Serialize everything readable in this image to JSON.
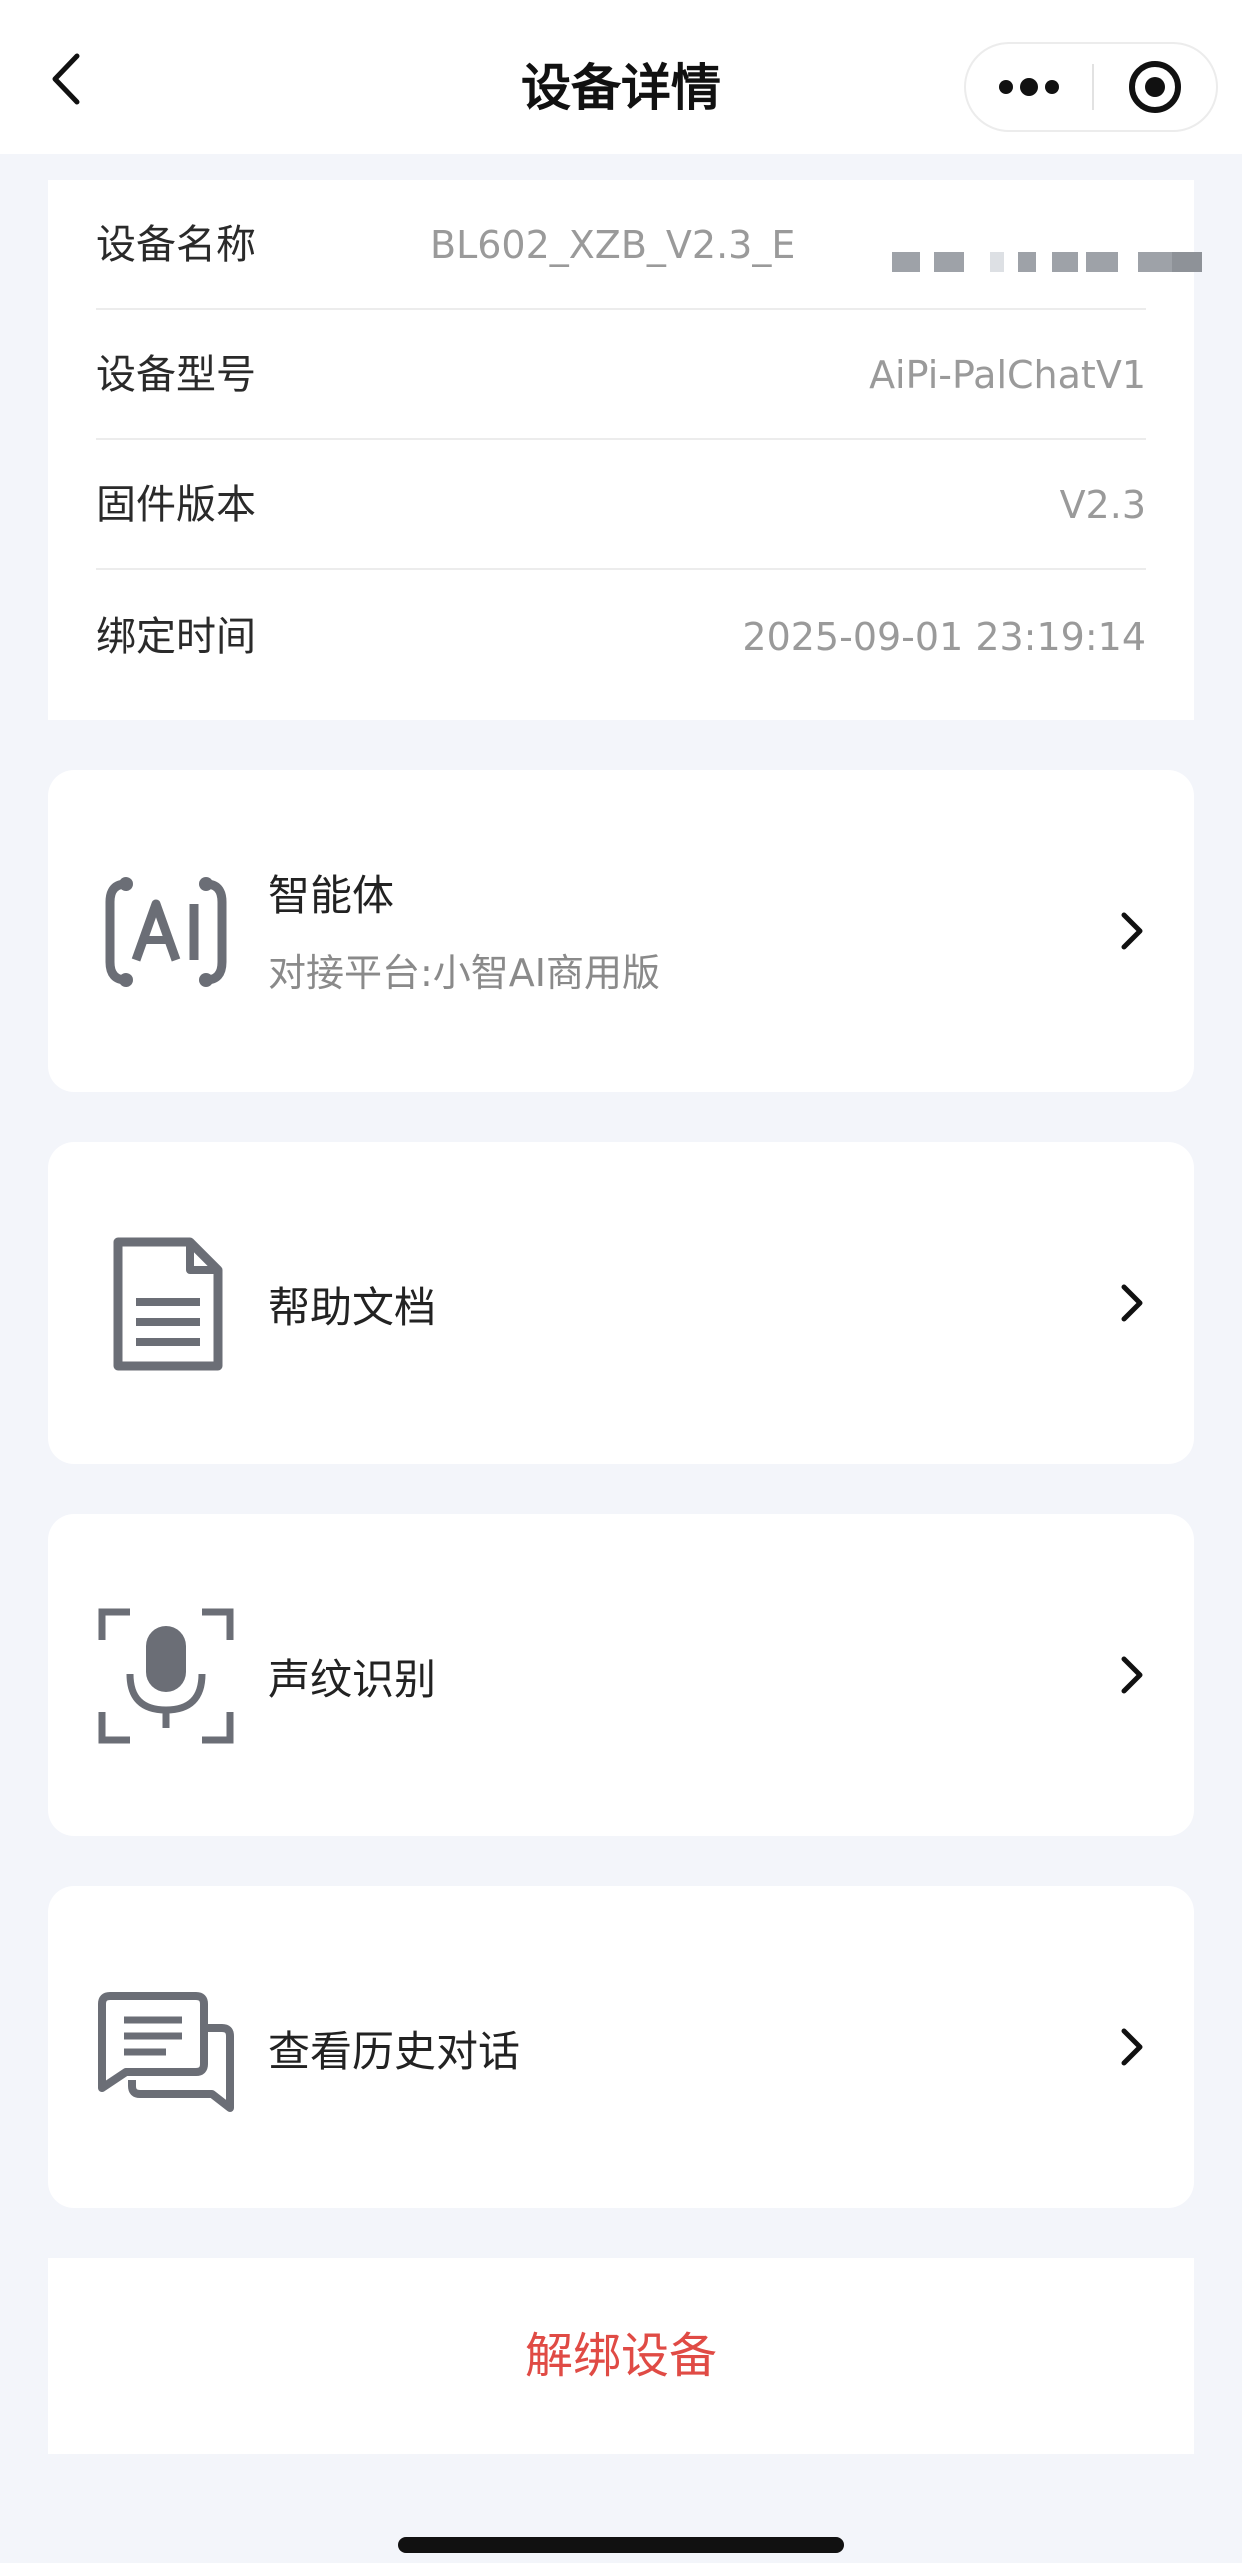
{
  "navbar": {
    "title": "设备详情",
    "back_icon": "chevron-left-icon",
    "more_icon": "more-dots-icon",
    "close_icon": "target-close-icon"
  },
  "device_info": {
    "rows": [
      {
        "label": "设备名称",
        "value": "BL602_XZB_V2.3_E"
      },
      {
        "label": "设备型号",
        "value": "AiPi-PalChatV1"
      },
      {
        "label": "固件版本",
        "value": "V2.3"
      },
      {
        "label": "绑定时间",
        "value": "2025-09-01 23:19:14"
      }
    ]
  },
  "menu": {
    "agent": {
      "title": "智能体",
      "subtitle": "对接平台:小智AI商用版",
      "icon": "ai-icon"
    },
    "help_docs": {
      "title": "帮助文档",
      "icon": "document-icon"
    },
    "voiceprint": {
      "title": "声纹识别",
      "icon": "microphone-scan-icon"
    },
    "history": {
      "title": "查看历史对话",
      "icon": "chat-bubbles-icon"
    }
  },
  "unbind": {
    "label": "解绑设备",
    "color": "#e04b45"
  },
  "colors": {
    "background": "#f3f5fa",
    "card": "#ffffff",
    "icon_gray": "#6b6e76",
    "value_gray": "#9a9a9a"
  }
}
